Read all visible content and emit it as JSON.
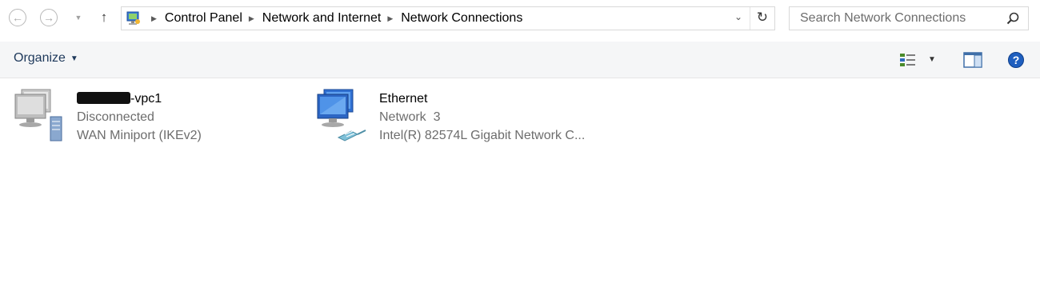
{
  "nav": {
    "back_icon": "arrow-left-icon",
    "forward_icon": "arrow-right-icon",
    "recent_icon": "chevron-down-icon",
    "up_icon": "arrow-up-icon"
  },
  "address": {
    "breadcrumbs": [
      "Control Panel",
      "Network and Internet",
      "Network Connections"
    ],
    "refresh_icon": "refresh-icon"
  },
  "search": {
    "placeholder": "Search Network Connections",
    "value": ""
  },
  "toolbar": {
    "organize_label": "Organize"
  },
  "connections": [
    {
      "name": "-vpc1",
      "name_redacted": true,
      "status": "Disconnected",
      "device": "WAN Miniport (IKEv2)",
      "icon": "vpn-connection-icon"
    },
    {
      "name": "Ethernet",
      "status": "Network  3",
      "device": "Intel(R) 82574L Gigabit Network C...",
      "icon": "ethernet-connection-icon"
    }
  ],
  "colors": {
    "command_bar_bg": "#f5f6f7",
    "organize_text": "#1e395b",
    "secondary_text": "#6d6d6d",
    "help_blue": "#1f5fbf"
  }
}
